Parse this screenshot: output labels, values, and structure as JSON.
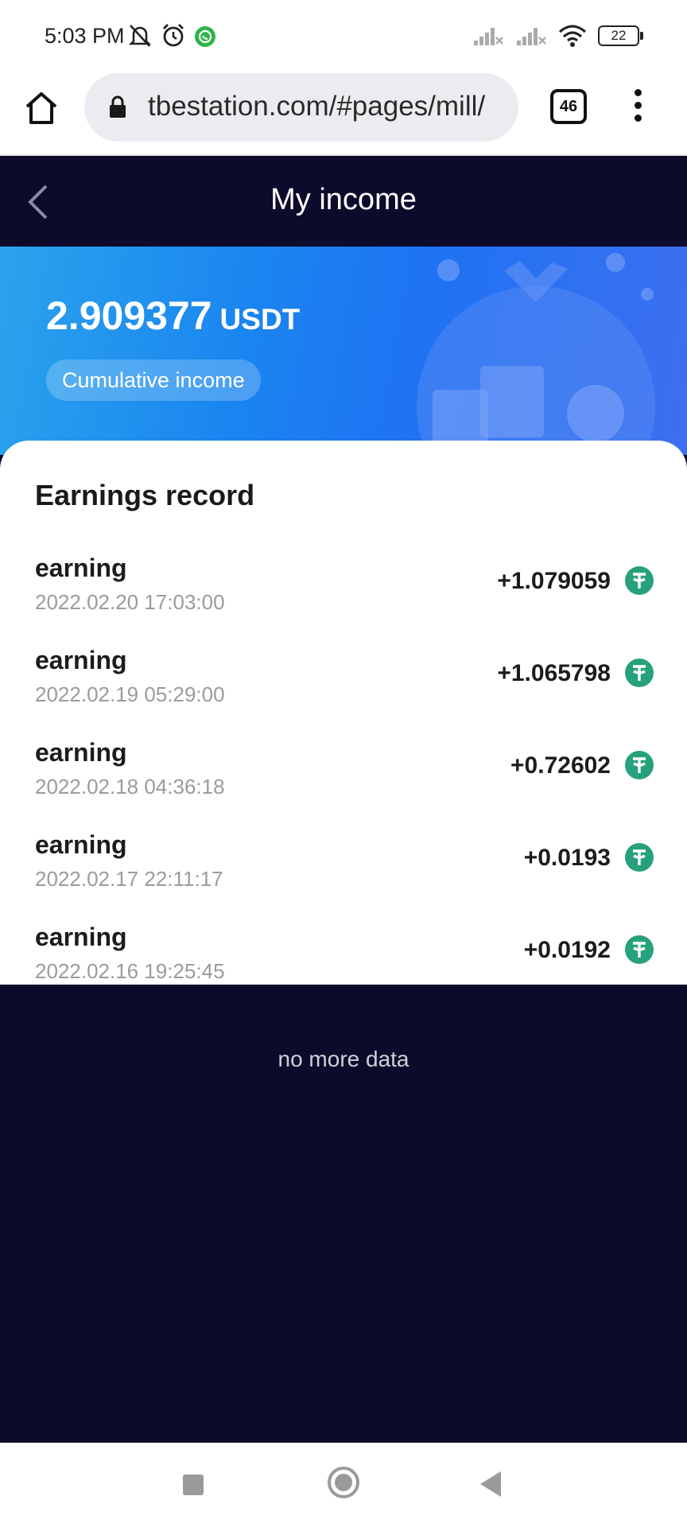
{
  "status_bar": {
    "time": "5:03 PM",
    "battery": "22",
    "icons": [
      "mute-icon",
      "alarm-icon",
      "whatsapp-icon",
      "signal-icon",
      "signal-icon",
      "wifi-icon",
      "battery-icon"
    ]
  },
  "browser": {
    "url": "tbestation.com/#pages/mill/",
    "tab_count": "46"
  },
  "header": {
    "title": "My income"
  },
  "summary": {
    "amount": "2.909377",
    "unit": "USDT",
    "label": "Cumulative income"
  },
  "records": {
    "title": "Earnings record",
    "items": [
      {
        "label": "earning",
        "date": "2022.02.20 17:03:00",
        "amount": "+1.079059"
      },
      {
        "label": "earning",
        "date": "2022.02.19 05:29:00",
        "amount": "+1.065798"
      },
      {
        "label": "earning",
        "date": "2022.02.18 04:36:18",
        "amount": "+0.72602"
      },
      {
        "label": "earning",
        "date": "2022.02.17 22:11:17",
        "amount": "+0.0193"
      },
      {
        "label": "earning",
        "date": "2022.02.16 19:25:45",
        "amount": "+0.0192"
      }
    ]
  },
  "footer": {
    "no_more": "no more data"
  },
  "colors": {
    "header_bg": "#0d0b2b",
    "banner_blue": "#1e86f0",
    "tether_green": "#26a17b"
  }
}
